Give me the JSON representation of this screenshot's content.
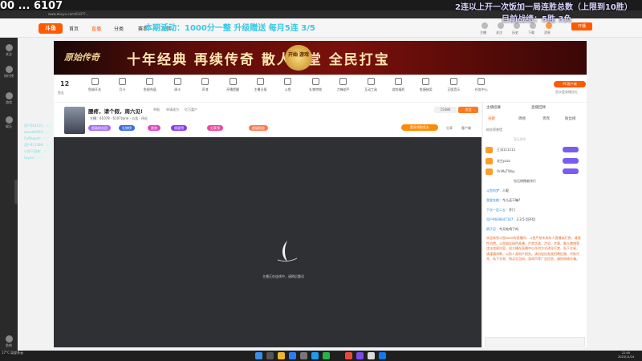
{
  "overlay": {
    "score": "00 ... 6107",
    "rules": "2连以上开一次饭加一局连胜总数（上限到10胜）",
    "record": "目前战绩：5胜 3负",
    "ticker": "本期活动：1000分一整 升级赠送 每月5连 3/5"
  },
  "browser": {
    "address": "www.douyu.com/6107?..."
  },
  "site": {
    "logo": "斗鱼",
    "nav": [
      "首页",
      "直播",
      "分类",
      "赛事",
      "视频"
    ],
    "header_actions": [
      "主播",
      "关注",
      "历史",
      "下载",
      "消息"
    ],
    "open_live": "开播"
  },
  "sidebar": [
    {
      "label": "关注"
    },
    {
      "label": "排行榜"
    },
    {
      "label": "游戏"
    },
    {
      "label": "娱乐"
    },
    {
      "label": "鱼吧"
    }
  ],
  "banner": {
    "brand": "原始传奇",
    "slogan": "十年经典 再续传奇 散人天堂 全民打宝",
    "cta": "开始 游戏"
  },
  "toolbar": {
    "level": "12",
    "level_label": "鱼丸",
    "items": [
      "鱼翅开关",
      "月卡",
      "鱼翅充值",
      "周卡",
      "声浪",
      "开播提醒",
      "主播日报",
      "斗鱼",
      "礼物特效",
      "刀锋助手",
      "互动工具",
      "游戏福利",
      "鱼塘抽奖",
      "正版音乐",
      "任务中心"
    ],
    "pc_gift": "PC客户端",
    "pc_gift_sub": "首次登录赠送礼"
  },
  "room": {
    "title": "腰疼，请个假，周六见!",
    "category": "举报",
    "category2": "申请成为",
    "category3": "亿万富户",
    "streamer": "主播：61078 · 6107zone · 公告 · 评论",
    "tags": [
      "超级粉丝团",
      "礼物榜",
      "贵宾",
      "周星榜",
      "分享领",
      "超级粉丝"
    ],
    "subscribers": "15486",
    "follow": "关注",
    "login_bonus": "登录领取鱼丸",
    "share": "分享",
    "client": "客户端"
  },
  "player": {
    "message": "主播正在连线中，请稍后重试"
  },
  "rightpanel": {
    "tabs": [
      "主播招募",
      "直播回顾",
      "贡献",
      "周榜",
      "贵宾",
      "粉丝榜"
    ],
    "header": "粉丝荣誉墙",
    "vip_note": "暂无贵宾",
    "users": [
      "王涛111111",
      "花生pzzz",
      "OnMyTWay"
    ],
    "rank_title": "钻石捐赠者排行",
    "chat": [
      {
        "name": "斗鱼的梦：",
        "text": "人呢"
      },
      {
        "name": "我爱吃桃：",
        "text": "今儿还干嘛?"
      },
      {
        "name": "下次一定二五：",
        "text": "开门"
      },
      {
        "name": "用户9669847167：",
        "text": "3 3 5 切不切"
      },
      {
        "name": "狮子忍：",
        "text": "今天吃鸡了吗"
      }
    ],
    "notice": "欢迎来到斗鱼zone的直播间，斗鱼严禁未成年人直播或打赏，请理性消费。斗鱼倡导绿色直播，严禁涉政、涉恐、涉黄、聚众赌博等违法违规内容，如主播在直播中以任何方式诱导打赏、私下交易，请谨慎判断，以防人身财产损失。请勿轻信各类招聘征婚、代练代充、私下交易、购买礼包码、游戏币等广告信息，谨防网络诈骗。"
  },
  "overlay_chat": [
    {
      "name": "用户561131：",
      "text": "来了"
    },
    {
      "name": "wandell003：",
      "text": "来了"
    },
    {
      "name": "Coffeepdt：",
      "text": "来了"
    },
    {
      "name": "用户411388：",
      "text": "来了"
    },
    {
      "name": "小鱼干回来：",
      "text": "来了"
    },
    {
      "name": "loiyan：",
      "text": "来了"
    }
  ],
  "taskbar": {
    "weather": "17°C 局部多云",
    "time": "22:00",
    "date": "2023/11/24"
  }
}
